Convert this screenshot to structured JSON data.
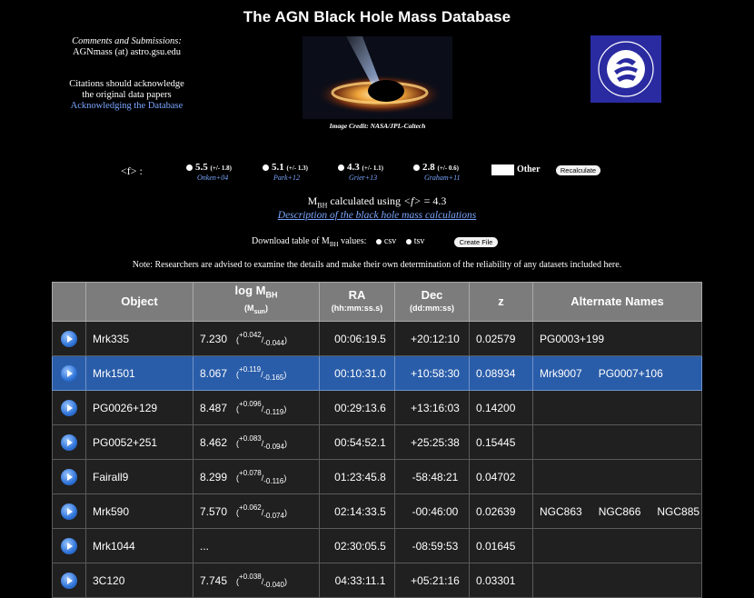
{
  "header": {
    "title": "The AGN Black Hole Mass Database"
  },
  "info": {
    "comments_heading": "Comments and Submissions:",
    "email": "AGNmass (at) astro.gsu.edu",
    "citation_line1": "Citations should acknowledge",
    "citation_line2": "the original data papers",
    "ack_link": "Acknowledging the Database"
  },
  "image_credit": "Image Credit: NASA/JPL-Caltech",
  "f_factor": {
    "symbol": "<f> :",
    "options": [
      {
        "value": "5.5",
        "err": "(+/- 1.8)",
        "ref": "Onken+04"
      },
      {
        "value": "5.1",
        "err": "(+/- 1.3)",
        "ref": "Park+12"
      },
      {
        "value": "4.3",
        "err": "(+/- 1.1)",
        "ref": "Grier+13"
      },
      {
        "value": "2.8",
        "err": "(+/- 0.6)",
        "ref": "Graham+11"
      }
    ],
    "other_label": "Other",
    "recalculate": "Recalculate"
  },
  "calc": {
    "m": "M",
    "bh": "BH",
    "text": " calculated using ",
    "f": "<f>",
    "eq": " = 4.3",
    "description_link": "Description of the black hole mass calculations"
  },
  "download": {
    "prefix": "Download table of M",
    "bh": "BH",
    "suffix": " values:",
    "opt_csv": "csv",
    "opt_tsv": "tsv",
    "create_file": "Create File"
  },
  "note": "Note: Researchers are advised to examine the details and make their own determination of the reliability of any datasets included here.",
  "table": {
    "headers": {
      "object": "Object",
      "logm": "log M",
      "logm_sub": "BH",
      "logm_unit": "(M",
      "logm_unit_sub": "sun",
      "logm_unit_close": ")",
      "ra": "RA",
      "ra_unit": "(hh:mm:ss.s)",
      "dec": "Dec",
      "dec_unit": "(dd:mm:ss)",
      "z": "z",
      "alt": "Alternate Names"
    },
    "rows": [
      {
        "object": "Mrk335",
        "logm": "7.230",
        "plus": "+0.042",
        "minus": "-0.044",
        "ra": "00:06:19.5",
        "dec": "+20:12:10",
        "z": "0.02579",
        "alt": [
          "PG0003+199"
        ]
      },
      {
        "object": "Mrk1501",
        "logm": "8.067",
        "plus": "+0.119",
        "minus": "-0.165",
        "ra": "00:10:31.0",
        "dec": "+10:58:30",
        "z": "0.08934",
        "alt": [
          "Mrk9007",
          "PG0007+106"
        ]
      },
      {
        "object": "PG0026+129",
        "logm": "8.487",
        "plus": "+0.096",
        "minus": "-0.119",
        "ra": "00:29:13.6",
        "dec": "+13:16:03",
        "z": "0.14200",
        "alt": []
      },
      {
        "object": "PG0052+251",
        "logm": "8.462",
        "plus": "+0.083",
        "minus": "-0.094",
        "ra": "00:54:52.1",
        "dec": "+25:25:38",
        "z": "0.15445",
        "alt": []
      },
      {
        "object": "Fairall9",
        "logm": "8.299",
        "plus": "+0.078",
        "minus": "-0.116",
        "ra": "01:23:45.8",
        "dec": "-58:48:21",
        "z": "0.04702",
        "alt": []
      },
      {
        "object": "Mrk590",
        "logm": "7.570",
        "plus": "+0.062",
        "minus": "-0.074",
        "ra": "02:14:33.5",
        "dec": "-00:46:00",
        "z": "0.02639",
        "alt": [
          "NGC863",
          "NGC866",
          "NGC885"
        ]
      },
      {
        "object": "Mrk1044",
        "logm": "...",
        "plus": "",
        "minus": "",
        "ra": "02:30:05.5",
        "dec": "-08:59:53",
        "z": "0.01645",
        "alt": []
      },
      {
        "object": "3C120",
        "logm": "7.745",
        "plus": "+0.038",
        "minus": "-0.040",
        "ra": "04:33:11.1",
        "dec": "+05:21:16",
        "z": "0.03301",
        "alt": []
      }
    ]
  },
  "colors": {
    "background": "#000000",
    "link": "#7aa6ff",
    "header_cell": "#7c7c7c",
    "row": "#202020",
    "selected_row": "#2a5da9",
    "logo_bg": "#2a2ba1"
  }
}
